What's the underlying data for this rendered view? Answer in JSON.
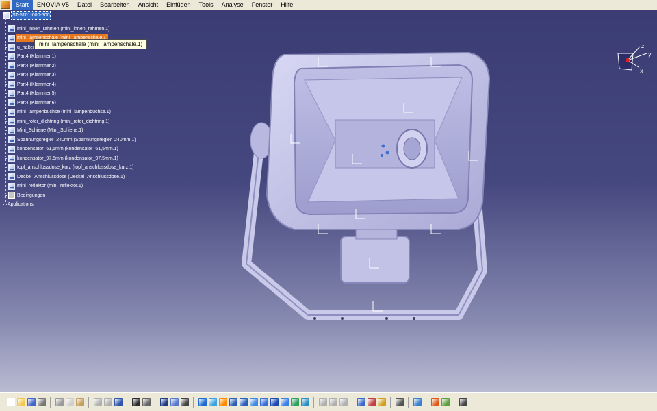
{
  "menu": {
    "items": [
      {
        "label": "Start",
        "active": true
      },
      {
        "label": "ENOVIA V5",
        "active": false
      },
      {
        "label": "Datei",
        "active": false
      },
      {
        "label": "Bearbeiten",
        "active": false
      },
      {
        "label": "Ansicht",
        "active": false
      },
      {
        "label": "Einfügen",
        "active": false
      },
      {
        "label": "Tools",
        "active": false
      },
      {
        "label": "Analyse",
        "active": false
      },
      {
        "label": "Fenster",
        "active": false
      },
      {
        "label": "Hilfe",
        "active": false
      }
    ]
  },
  "tree": {
    "root": {
      "label": "ST-5101-000-500",
      "icon": "product-icon"
    },
    "items": [
      {
        "label": "mini_innen_rahmen (mini_innen_rahmen.1)",
        "icon": "part-icon",
        "selected": false
      },
      {
        "label": "mini_lampenschale (mini_lampenschale.1)",
        "icon": "part-icon",
        "selected": true
      },
      {
        "label": "u_halter",
        "icon": "part-icon",
        "selected": false
      },
      {
        "label": "Part4 (Klammer.1)",
        "icon": "part-icon",
        "selected": false
      },
      {
        "label": "Part4 (Klammer.2)",
        "icon": "part-icon",
        "selected": false
      },
      {
        "label": "Part4 (Klammer.3)",
        "icon": "part-icon",
        "selected": false
      },
      {
        "label": "Part4 (Klammer.4)",
        "icon": "part-icon",
        "selected": false
      },
      {
        "label": "Part4 (Klammer.5)",
        "icon": "part-icon",
        "selected": false
      },
      {
        "label": "Part4 (Klammer.6)",
        "icon": "part-icon",
        "selected": false
      },
      {
        "label": "mini_lampenbuchse (mini_lampenbuchse.1)",
        "icon": "part-icon",
        "selected": false
      },
      {
        "label": "mini_roter_dichtring (mini_roter_dichtring.1)",
        "icon": "part-icon",
        "selected": false
      },
      {
        "label": "Mini_Schiene (Mini_Schiene.1)",
        "icon": "part-icon",
        "selected": false
      },
      {
        "label": "Spannungsregler_240mm (Spannungsregler_240mm.1)",
        "icon": "part-icon",
        "selected": false
      },
      {
        "label": "kondensator_61,5mm (kondensator_61,5mm.1)",
        "icon": "part-icon",
        "selected": false
      },
      {
        "label": "kondensator_97,5mm (kondensator_97,5mm.1)",
        "icon": "part-icon",
        "selected": false
      },
      {
        "label": "topf_anschlussdose_kurz (topf_anschlussdose_kurz.1)",
        "icon": "part-icon",
        "selected": false
      },
      {
        "label": "Deckel_Anschlussdose (Deckel_Anschlussdose.1)",
        "icon": "part-icon",
        "selected": false
      },
      {
        "label": "mini_reflektor (mini_reflektor.1)",
        "icon": "part-icon",
        "selected": false
      },
      {
        "label": "Bedingungen",
        "icon": "constraints-icon",
        "selected": false
      }
    ],
    "applications": {
      "label": "Applications"
    }
  },
  "tooltip": {
    "text": "mini_lampenschale (mini_lampenschale.1)"
  },
  "compass": {
    "axis_x": "x",
    "axis_y": "y",
    "axis_z": "z"
  },
  "toolbar": {
    "buttons": [
      {
        "name": "new-icon",
        "color": "#ffffff"
      },
      {
        "name": "open-icon",
        "color": "#f2c94c"
      },
      {
        "name": "save-icon",
        "color": "#4466cc"
      },
      {
        "name": "print-icon",
        "color": "#777777"
      },
      {
        "name": "sep"
      },
      {
        "name": "cut-icon",
        "color": "#9a9a9a"
      },
      {
        "name": "copy-icon",
        "color": "#cfcfcf"
      },
      {
        "name": "paste-icon",
        "color": "#c4a060"
      },
      {
        "name": "sep"
      },
      {
        "name": "undo-icon",
        "color": "#b0b0b0"
      },
      {
        "name": "redo-icon",
        "color": "#b0b0b0"
      },
      {
        "name": "whats-this-icon",
        "color": "#3355aa"
      },
      {
        "name": "sep"
      },
      {
        "name": "formula-icon",
        "color": "#2c2c2c"
      },
      {
        "name": "comment-icon",
        "color": "#666666"
      },
      {
        "name": "sep"
      },
      {
        "name": "table-icon",
        "color": "#203a80"
      },
      {
        "name": "graph-icon",
        "color": "#5a7acc"
      },
      {
        "name": "macro-icon",
        "color": "#444444"
      },
      {
        "name": "sep"
      },
      {
        "name": "fit-all-icon",
        "color": "#1f6bd0"
      },
      {
        "name": "pan-icon",
        "color": "#3aa3e0"
      },
      {
        "name": "rotate-icon",
        "color": "#ff8a00"
      },
      {
        "name": "zoom-in-icon",
        "color": "#2a5fb8"
      },
      {
        "name": "zoom-out-icon",
        "color": "#2a5fb8"
      },
      {
        "name": "normal-view-icon",
        "color": "#3d8be0"
      },
      {
        "name": "multi-view-icon",
        "color": "#3a6fd8"
      },
      {
        "name": "iso-view-icon",
        "color": "#1b4bb0"
      },
      {
        "name": "shading-icon",
        "color": "#3a80e6"
      },
      {
        "name": "hide-show-icon",
        "color": "#2fa060"
      },
      {
        "name": "swap-visible-icon",
        "color": "#2a8fc4"
      },
      {
        "name": "sep"
      },
      {
        "name": "assembly-constraint-icon",
        "color": "#b0b0b0"
      },
      {
        "name": "manipulation-icon",
        "color": "#b0b0b0"
      },
      {
        "name": "snap-icon",
        "color": "#b0b0b0"
      },
      {
        "name": "sep"
      },
      {
        "name": "explode-icon",
        "color": "#3b6ac8"
      },
      {
        "name": "clash-icon",
        "color": "#c04040"
      },
      {
        "name": "section-icon",
        "color": "#d2a020"
      },
      {
        "name": "sep"
      },
      {
        "name": "update-icon",
        "color": "#555555"
      },
      {
        "name": "sep"
      },
      {
        "name": "measure-icon",
        "color": "#3a7fd0"
      },
      {
        "name": "sep"
      },
      {
        "name": "catalog-icon",
        "color": "#e05a1a"
      },
      {
        "name": "material-icon",
        "color": "#60a040"
      },
      {
        "name": "sep"
      },
      {
        "name": "workbench-icon",
        "color": "#444444"
      }
    ]
  }
}
